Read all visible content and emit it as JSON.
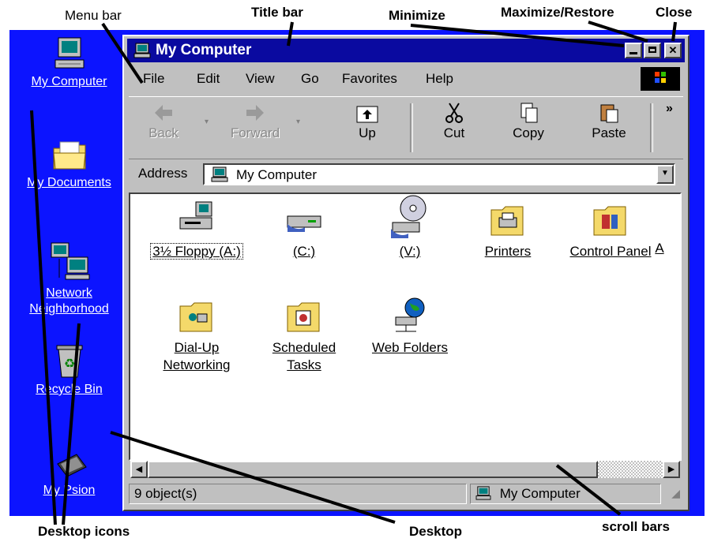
{
  "annotations": {
    "menu_bar": "Menu bar",
    "title_bar": "Title bar",
    "minimize": "Minimize",
    "maximize_restore": "Maximize/Restore",
    "close": "Close",
    "desktop_icons": "Desktop icons",
    "desktop": "Desktop",
    "scroll_bars": "scroll bars"
  },
  "desktop_icons": [
    {
      "label": "My Computer",
      "icon": "my-computer-icon"
    },
    {
      "label": "My Documents",
      "icon": "folder-icon"
    },
    {
      "label": "Network Neighborhood",
      "icon": "network-icon"
    },
    {
      "label": "Recycle Bin",
      "icon": "recycle-bin-icon"
    },
    {
      "label": "My Psion",
      "icon": "psion-icon"
    }
  ],
  "window": {
    "title": "My Computer",
    "menu": [
      "File",
      "Edit",
      "View",
      "Go",
      "Favorites",
      "Help"
    ],
    "toolbar": [
      {
        "label": "Back",
        "icon": "back-arrow-icon",
        "enabled": false
      },
      {
        "label": "Forward",
        "icon": "forward-arrow-icon",
        "enabled": false
      },
      {
        "label": "Up",
        "icon": "up-folder-icon",
        "enabled": true
      },
      {
        "label": "Cut",
        "icon": "scissors-icon",
        "enabled": true
      },
      {
        "label": "Copy",
        "icon": "copy-icon",
        "enabled": true
      },
      {
        "label": "Paste",
        "icon": "paste-icon",
        "enabled": true
      }
    ],
    "toolbar_overflow": "»",
    "address_label": "Address",
    "address_value": "My Computer",
    "items": [
      {
        "label": "3½ Floppy (A:)",
        "icon": "floppy-drive-icon"
      },
      {
        "label": "(C:)",
        "icon": "hard-drive-icon"
      },
      {
        "label": "(V:)",
        "icon": "cd-drive-icon"
      },
      {
        "label": "Printers",
        "icon": "printers-folder-icon"
      },
      {
        "label": "Control Panel",
        "icon": "control-panel-icon"
      },
      {
        "label": "A",
        "icon": ""
      },
      {
        "label": "Dial-Up Networking",
        "icon": "dialup-folder-icon"
      },
      {
        "label": "Scheduled Tasks",
        "icon": "scheduled-tasks-icon"
      },
      {
        "label": "Web Folders",
        "icon": "web-folders-icon"
      }
    ],
    "status_left": "9 object(s)",
    "status_right": "My Computer"
  },
  "colors": {
    "desktop": "#0c14ff",
    "titlebar": "#0a0aa0",
    "chrome": "#c0c0c0"
  }
}
